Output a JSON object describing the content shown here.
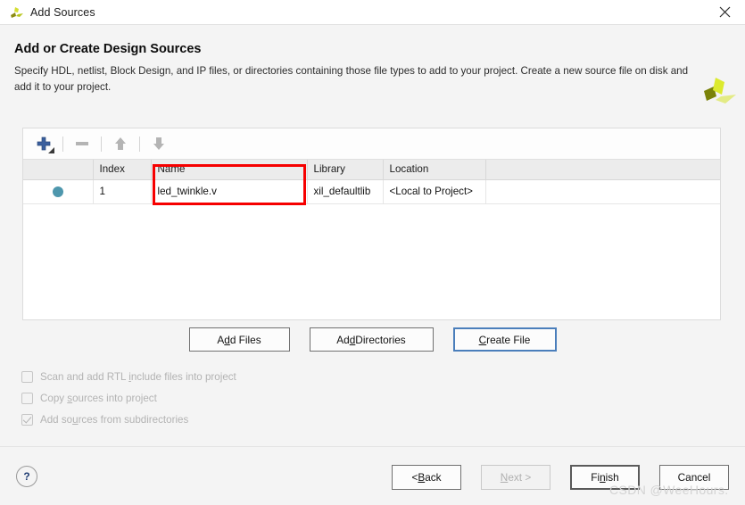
{
  "window": {
    "title": "Add Sources",
    "logo_icon": "vivado-logo-icon",
    "close_icon": "close-icon"
  },
  "header": {
    "title": "Add or Create Design Sources",
    "description": "Specify HDL, netlist, Block Design, and IP files, or directories containing those file types to add to your project. Create a new source file on disk and add it to your project.",
    "brand_logo_icon": "xilinx-logo-icon"
  },
  "sources_panel": {
    "toolbar": [
      {
        "name": "add-source-button",
        "icon": "plus-icon",
        "enabled": true
      },
      {
        "name": "remove-source-button",
        "icon": "minus-icon",
        "enabled": false
      },
      {
        "name": "move-up-button",
        "icon": "arrow-up-icon",
        "enabled": false
      },
      {
        "name": "move-down-button",
        "icon": "arrow-down-icon",
        "enabled": false
      }
    ],
    "table": {
      "columns": [
        "",
        "Index",
        "Name",
        "Library",
        "Location",
        ""
      ],
      "rows": [
        {
          "status_icon": "blue-dot-icon",
          "index": "1",
          "name": "led_twinkle.v",
          "library": "xil_defaultlib",
          "location": "<Local to Project>"
        }
      ],
      "highlight": {
        "target": "name-column",
        "color": "#f60000"
      }
    }
  },
  "mid_buttons": {
    "add_files": {
      "pre": "A",
      "mnemonic": "d",
      "post": "d Files"
    },
    "add_directories": {
      "pre": "Ad",
      "mnemonic": "d",
      "post": " Directories"
    },
    "create_file": {
      "pre": "",
      "mnemonic": "C",
      "post": "reate File"
    }
  },
  "options": [
    {
      "label_pre": "Scan and add RTL ",
      "mnemonic": "i",
      "label_post": "nclude files into project",
      "checked": false,
      "enabled": false
    },
    {
      "label_pre": "Copy ",
      "mnemonic": "s",
      "label_post": "ources into project",
      "checked": false,
      "enabled": false
    },
    {
      "label_pre": "Add so",
      "mnemonic": "u",
      "label_post": "rces from subdirectories",
      "checked": true,
      "enabled": false
    }
  ],
  "footer": {
    "help": "?",
    "back": {
      "pre": "< ",
      "mnemonic": "B",
      "post": "ack"
    },
    "next": {
      "pre": "",
      "mnemonic": "N",
      "post": "ext >"
    },
    "finish": {
      "pre": "Fi",
      "mnemonic": "n",
      "post": "ish"
    },
    "cancel": {
      "pre": "Cancel",
      "mnemonic": "",
      "post": ""
    }
  },
  "watermark": "CSDN @WeeHours."
}
